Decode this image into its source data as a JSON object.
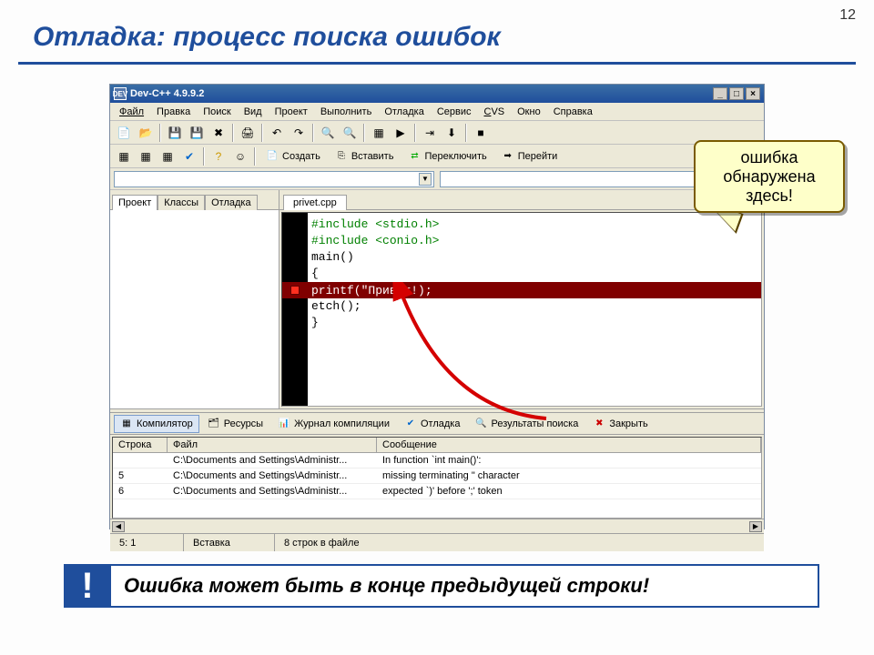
{
  "page_number": "12",
  "slide_title": "Отладка: процесс поиска ошибок",
  "window": {
    "title": "Dev-C++ 4.9.9.2",
    "app_icon_text": "DEV",
    "btn_min": "_",
    "btn_max": "□",
    "btn_close": "×"
  },
  "menu": {
    "file": "Файл",
    "edit": "Правка",
    "search": "Поиск",
    "view": "Вид",
    "project": "Проект",
    "execute": "Выполнить",
    "debug": "Отладка",
    "tools": "Сервис",
    "cvs": "CVS",
    "window": "Окно",
    "help": "Справка"
  },
  "toolbar2": {
    "create": "Создать",
    "insert": "Вставить",
    "switch": "Переключить",
    "goto": "Перейти"
  },
  "side_tabs": {
    "project": "Проект",
    "classes": "Классы",
    "debug": "Отладка"
  },
  "file_tab": "privet.cpp",
  "code": {
    "l1": "#include <stdio.h>",
    "l2": "#include <conio.h>",
    "l3": "main()",
    "l4": "{",
    "err": "printf(\"Привет!);",
    "l6": "etch();",
    "l7": "}"
  },
  "output_tabs": {
    "compiler": "Компилятор",
    "resources": "Ресурсы",
    "log": "Журнал компиляции",
    "debug": "Отладка",
    "search": "Результаты поиска",
    "close": "Закрыть"
  },
  "grid": {
    "head_line": "Строка",
    "head_file": "Файл",
    "head_msg": "Сообщение",
    "rows": [
      {
        "line": "",
        "file": "C:\\Documents and Settings\\Administr...",
        "msg": "In function `int main()':"
      },
      {
        "line": "5",
        "file": "C:\\Documents and Settings\\Administr...",
        "msg": "missing terminating \" character"
      },
      {
        "line": "6",
        "file": "C:\\Documents and Settings\\Administr...",
        "msg": "expected `)' before ';' token"
      }
    ]
  },
  "status": {
    "pos": "5: 1",
    "mode": "Вставка",
    "lines": "8 строк в файле"
  },
  "callout_text": "ошибка обнаружена здесь!",
  "note": {
    "bang": "!",
    "text": "Ошибка может быть в конце предыдущей строки!"
  }
}
